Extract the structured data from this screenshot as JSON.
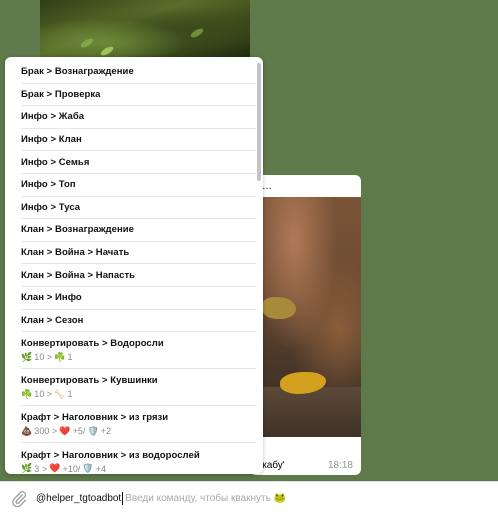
{
  "chat": {
    "message": {
      "caption_top": "…",
      "caption_bottom": "жабу'",
      "time": "18:18"
    }
  },
  "commands": [
    {
      "label": "Брак > Вознаграждение"
    },
    {
      "label": "Брак > Проверка"
    },
    {
      "label": "Инфо > Жаба"
    },
    {
      "label": "Инфо > Клан"
    },
    {
      "label": "Инфо > Семья"
    },
    {
      "label": "Инфо > Топ"
    },
    {
      "label": "Инфо > Туса"
    },
    {
      "label": "Клан > Вознаграждение"
    },
    {
      "label": "Клан > Война > Начать"
    },
    {
      "label": "Клан > Война > Напасть"
    },
    {
      "label": "Клан > Инфо"
    },
    {
      "label": "Клан > Сезон"
    },
    {
      "label": "Конвертировать > Водоросли",
      "sub": {
        "a_icon": "🌿",
        "a_val": "10 >",
        "b_icon": "☘️",
        "b_val": "1"
      }
    },
    {
      "label": "Конвертировать > Кувшинки",
      "sub": {
        "a_icon": "☘️",
        "a_val": "10 >",
        "b_icon": "🦴",
        "b_val": "1"
      }
    },
    {
      "label": "Крафт > Наголовник > из грязи",
      "sub": {
        "a_icon": "💩",
        "a_val": "300 >",
        "b_icon": "❤️",
        "b_val": "+5/",
        "c_icon": "🛡️",
        "c_val": "+2"
      }
    },
    {
      "label": "Крафт > Наголовник > из водорослей",
      "sub": {
        "a_icon": "🌿",
        "a_val": "3 >",
        "b_icon": "❤️",
        "b_val": "+10/",
        "c_icon": "🛡️",
        "c_val": "+4"
      }
    }
  ],
  "input": {
    "value": "@helper_tgtoadbot",
    "placeholder": "Введи команду, чтобы квакнуть 🐸"
  },
  "icons": {
    "attach": "paperclip-icon"
  }
}
